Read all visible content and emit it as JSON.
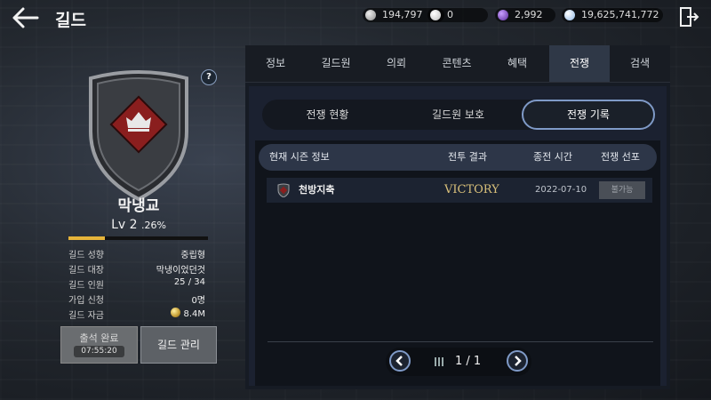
{
  "header": {
    "title": "길드",
    "currencies": [
      {
        "name": "silver",
        "value": "194,797",
        "color": "#b8b8b8"
      },
      {
        "name": "pearl",
        "value": "0",
        "color": "#e9e9e9"
      },
      {
        "name": "purple-gem",
        "value": "2,992",
        "color": "#7a3fbf"
      },
      {
        "name": "diamond",
        "value": "19,625,741,772",
        "color": "#cfe4ff"
      }
    ]
  },
  "profile": {
    "name": "막냉교",
    "level_prefix": "Lv 2",
    "level_pct": ".26%",
    "exp_progress": 0.26,
    "info": [
      {
        "label": "길드 성향",
        "value": "중립형"
      },
      {
        "label": "길드 대장",
        "value": "막냉이었던것"
      },
      {
        "label": "길드 인원",
        "value": "25 / 34"
      },
      {
        "label": "가입 신청",
        "value": "0명"
      },
      {
        "label": "길드 자금",
        "value": "8.4M"
      }
    ],
    "attend_label": "출석 완료",
    "attend_timer": "07:55:20",
    "manage_label": "길드 관리"
  },
  "tabs": [
    "정보",
    "길드원",
    "의뢰",
    "콘텐츠",
    "혜택",
    "전쟁",
    "검색"
  ],
  "active_tab": "전쟁",
  "subtabs": [
    "전쟁 현황",
    "길드원 보호",
    "전쟁 기록"
  ],
  "active_subtab": "전쟁 기록",
  "table": {
    "headers": [
      "현재 시즌 정보",
      "전투 결과",
      "종전 시간",
      "전쟁 선포"
    ],
    "rows": [
      {
        "name": "천방지축",
        "result": "VICTORY",
        "time": "2022-07-10",
        "action": "불가능"
      }
    ]
  },
  "pager": {
    "text": "1 / 1"
  },
  "colors": {
    "accent": "#7f9ac7",
    "exp_bar": "#e6b43a",
    "victory": "#d9c07a"
  }
}
